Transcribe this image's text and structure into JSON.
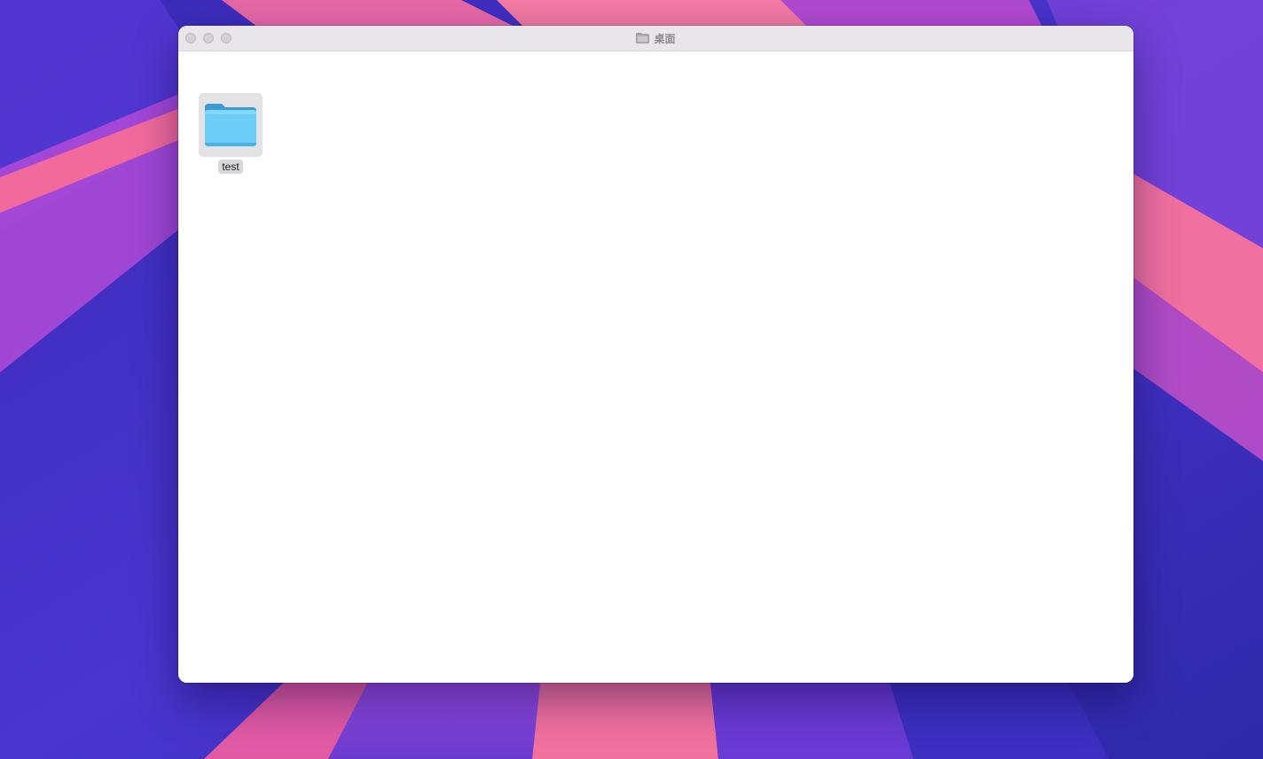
{
  "window": {
    "title": "桌面",
    "title_icon": "folder-icon"
  },
  "traffic_lights": [
    {
      "name": "close-button"
    },
    {
      "name": "minimize-button"
    },
    {
      "name": "zoom-button"
    }
  ],
  "items": [
    {
      "label": "test",
      "icon": "folder-icon",
      "selected": true
    }
  ],
  "colors": {
    "folder_body": "#6ccdf8",
    "folder_tab": "#3e9ad6",
    "titlebar": "#e8e6ea",
    "wallpaper_base": "#3b2fc4",
    "wallpaper_pink": "#f06aa0",
    "wallpaper_violet": "#8a4bd8"
  }
}
